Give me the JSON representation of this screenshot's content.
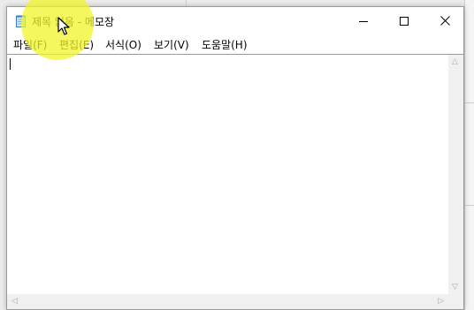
{
  "window": {
    "title": "제목 없음 - 메모장"
  },
  "menu": {
    "items": [
      {
        "label": "파일(F)"
      },
      {
        "label": "편집(E)"
      },
      {
        "label": "서식(O)"
      },
      {
        "label": "보기(V)"
      },
      {
        "label": "도움말(H)"
      }
    ]
  },
  "editor": {
    "content": ""
  },
  "colors": {
    "highlight": "#f0f528",
    "editor_border": "#7a9fd4"
  }
}
